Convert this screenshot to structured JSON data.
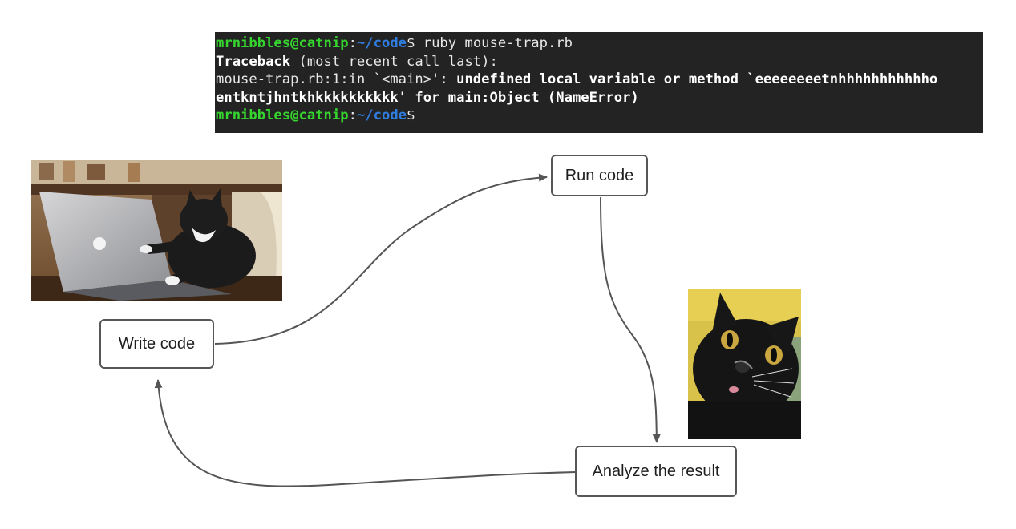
{
  "terminal": {
    "lines": [
      [
        {
          "text": "mrnibbles@catnip",
          "style": "user"
        },
        {
          "text": ":",
          "style": "plain"
        },
        {
          "text": "~/code",
          "style": "path"
        },
        {
          "text": "$ ruby mouse-trap.rb",
          "style": "plain"
        }
      ],
      [
        {
          "text": "Traceback",
          "style": "bold"
        },
        {
          "text": " (most recent call last):",
          "style": "plain"
        }
      ],
      [
        {
          "text": "mouse-trap.rb:1:in `<main>': ",
          "style": "plain"
        },
        {
          "text": "undefined local variable or method `eeeeeeeetnhhhhhhhhhhho",
          "style": "bold"
        }
      ],
      [
        {
          "text": "entkntjhntkhkkkkkkkkkk' for main:Object (",
          "style": "bold"
        },
        {
          "text": "NameError",
          "style": "bold ul"
        },
        {
          "text": ")",
          "style": "bold"
        }
      ],
      [
        {
          "text": "mrnibbles@catnip",
          "style": "user"
        },
        {
          "text": ":",
          "style": "plain"
        },
        {
          "text": "~/code",
          "style": "path"
        },
        {
          "text": "$",
          "style": "plain"
        }
      ]
    ]
  },
  "diagram": {
    "nodes": {
      "write": "Write code",
      "run": "Run code",
      "analyze": "Analyze the result"
    },
    "edges": [
      {
        "from": "write",
        "to": "run"
      },
      {
        "from": "run",
        "to": "analyze"
      },
      {
        "from": "analyze",
        "to": "write"
      }
    ]
  },
  "images": {
    "laptop_cat": "cat typing on laptop photo",
    "surprised_cat": "surprised black cat photo"
  },
  "colors": {
    "terminal_bg": "#232323",
    "prompt_user": "#36d62f",
    "prompt_path": "#2f7de0",
    "node_border": "#575757",
    "edge": "#555555"
  }
}
